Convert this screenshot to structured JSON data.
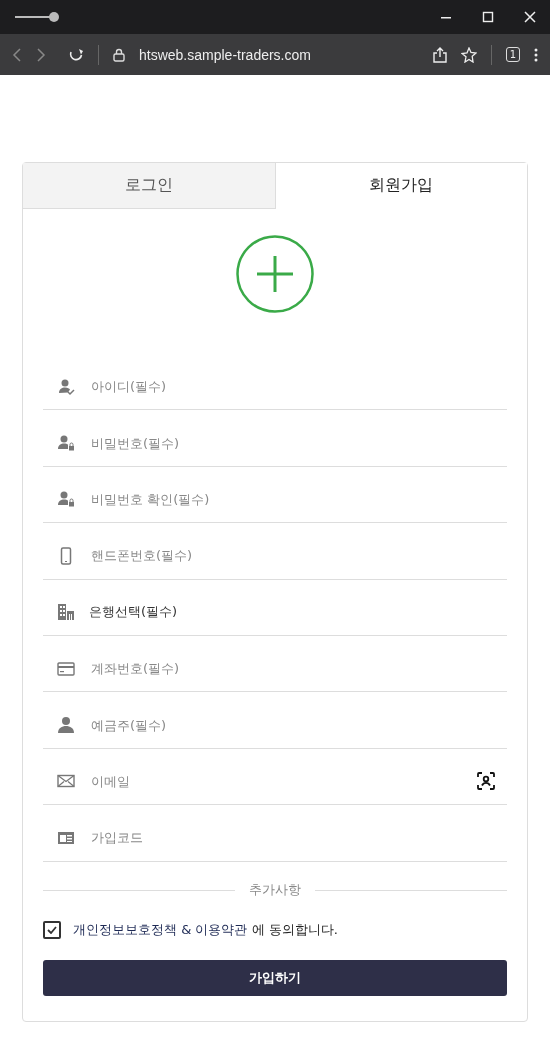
{
  "browser": {
    "url": "htsweb.sample-traders.com",
    "tab_count": "1"
  },
  "tabs": [
    {
      "label": "로그인",
      "selected": false
    },
    {
      "label": "회원가입",
      "selected": true
    }
  ],
  "fields": [
    {
      "kind": "plain",
      "placeholder": "아이디(필수)"
    },
    {
      "kind": "plain",
      "placeholder": "비밀번호(필수)"
    },
    {
      "kind": "plain",
      "placeholder": "비밀번호 확인(필수)"
    },
    {
      "kind": "plain",
      "placeholder": "핸드폰번호(필수)"
    },
    {
      "kind": "select",
      "placeholder": "은행선택(필수)"
    },
    {
      "kind": "plain",
      "placeholder": "계좌번호(필수)"
    },
    {
      "kind": "plain",
      "placeholder": "예금주(필수)"
    },
    {
      "kind": "scan",
      "placeholder": "이메일"
    },
    {
      "kind": "plain",
      "placeholder": "가입코드"
    }
  ],
  "section_label": "추가사항",
  "agree": {
    "checked": true,
    "link": "개인정보보호정책 & 이용약관",
    "text": "에 동의합니다."
  },
  "submit": "가입하기"
}
